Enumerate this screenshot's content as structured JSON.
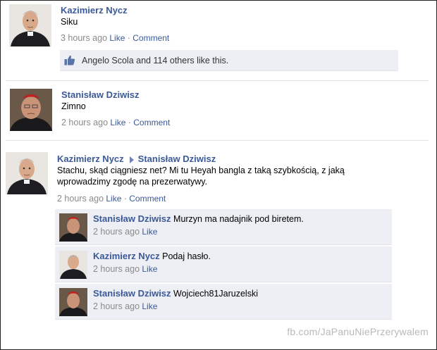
{
  "posts": [
    {
      "author": "Kazimierz Nycz",
      "text": "Siku",
      "time": "3 hours ago",
      "like_label": "Like",
      "sep": "·",
      "comment_label": "Comment",
      "likes_text": "Angelo Scola and 114 others like this."
    },
    {
      "author": "Stanisław Dziwisz",
      "text": "Zimno",
      "time": "2 hours ago",
      "like_label": "Like",
      "sep": "·",
      "comment_label": "Comment"
    },
    {
      "author": "Kazimierz Nycz",
      "target": "Stanisław Dziwisz",
      "text_line1": "Stachu, skąd ciągniesz net? Mi tu Heyah bangla z taką szybkością, z jaką",
      "text_line2": "wprowadzimy zgodę na prezerwatywy.",
      "time": "2 hours ago",
      "like_label": "Like",
      "sep": "·",
      "comment_label": "Comment",
      "comments": [
        {
          "author": "Stanisław Dziwisz",
          "text": "Murzyn ma nadajnik pod biretem.",
          "time": "2 hours ago",
          "like_label": "Like"
        },
        {
          "author": "Kazimierz Nycz",
          "text": "Podaj hasło.",
          "time": "2 hours ago",
          "like_label": "Like"
        },
        {
          "author": "Stanisław Dziwisz",
          "text": "Wojciech81Jaruzelski",
          "time": "2 hours ago",
          "like_label": "Like"
        }
      ]
    }
  ],
  "watermark": "fb.com/JaPanuNiePrzerywalem",
  "icons": {
    "like": "thumbs-up-icon"
  },
  "colors": {
    "link": "#3b5998",
    "meta": "#8a8a8a",
    "comment_bg": "#edeff4"
  }
}
